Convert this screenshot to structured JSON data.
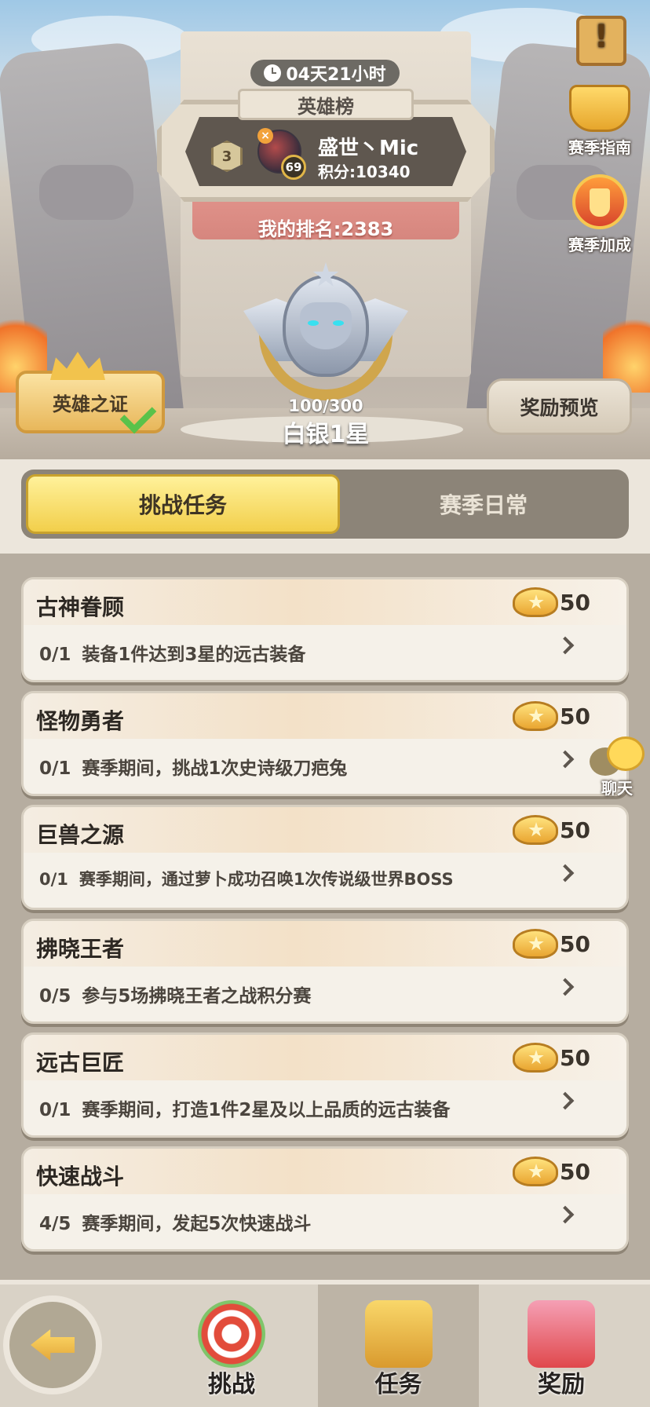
{
  "season": {
    "countdown": "04天21小时",
    "leaderboard_title": "英雄榜",
    "top_player": {
      "rank": "3",
      "level": "69",
      "name": "盛世丶Mic",
      "score": "积分:10340"
    },
    "my_rank": "我的排名:2383",
    "rank_progress": "100/300",
    "rank_tier": "白银1星"
  },
  "hero_buttons": {
    "hero_proof": "英雄之证",
    "reward_preview": "奖励预览"
  },
  "side_buttons": {
    "guide": "赛季指南",
    "bonus": "赛季加成",
    "notice_glyph": "!"
  },
  "tabs": {
    "active": "挑战任务",
    "inactive": "赛季日常"
  },
  "tasks": [
    {
      "title": "古神眷顾",
      "reward": "50",
      "progress": "0/1",
      "desc": "装备1件达到3星的远古装备"
    },
    {
      "title": "怪物勇者",
      "reward": "50",
      "progress": "0/1",
      "desc": "赛季期间，挑战1次史诗级刀疤兔"
    },
    {
      "title": "巨兽之源",
      "reward": "50",
      "progress": "0/1",
      "desc": "赛季期间，通过萝卜成功召唤1次传说级世界BOSS"
    },
    {
      "title": "拂晓王者",
      "reward": "50",
      "progress": "0/5",
      "desc": "参与5场拂晓王者之战积分赛"
    },
    {
      "title": "远古巨匠",
      "reward": "50",
      "progress": "0/1",
      "desc": "赛季期间，打造1件2星及以上品质的远古装备"
    },
    {
      "title": "快速战斗",
      "reward": "50",
      "progress": "4/5",
      "desc": "赛季期间，发起5次快速战斗"
    }
  ],
  "chat": {
    "label": "聊天"
  },
  "bottom_nav": {
    "challenge": "挑战",
    "task": "任务",
    "reward": "奖励"
  },
  "colors": {
    "active_tab": "#f2cf4b",
    "panel_bg": "#b6ada0",
    "card_bg": "#f5f1e9"
  }
}
